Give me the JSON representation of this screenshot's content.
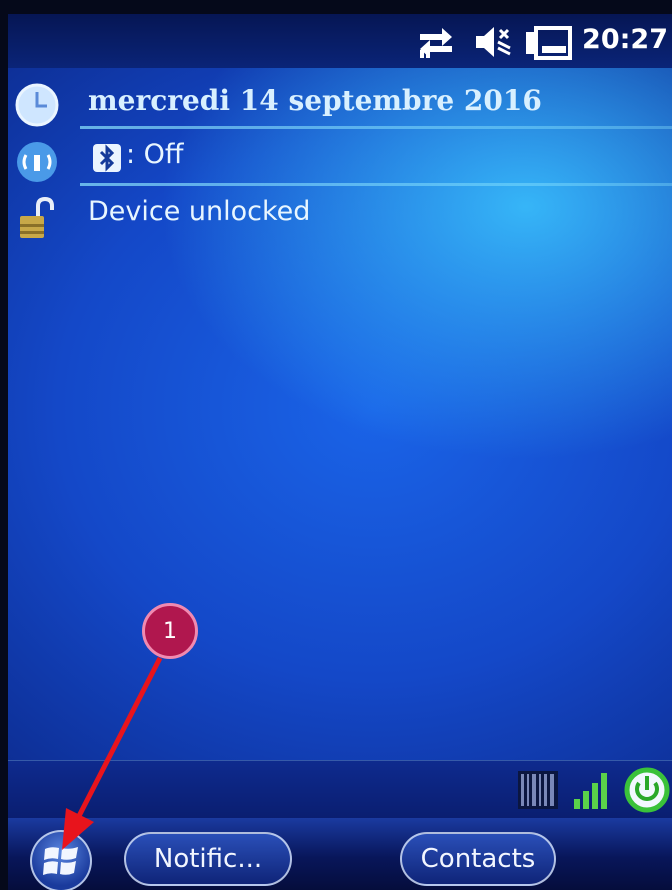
{
  "status_bar": {
    "time": "20:27",
    "icons": [
      "connectivity-arrows-icon",
      "speaker-muted-icon",
      "battery-icon"
    ]
  },
  "today": {
    "date": "mercredi 14 septembre 2016",
    "bluetooth_status": ": Off",
    "lock_status": "Device unlocked",
    "icons": [
      "clock-icon",
      "wireless-icon",
      "bluetooth-icon",
      "unlocked-padlock-icon"
    ]
  },
  "tray": {
    "icons": [
      "barcode-scanner-icon",
      "signal-strength-icon",
      "power-icon"
    ]
  },
  "softkeys": {
    "start_icon": "windows-start-icon",
    "left_label": "Notific...",
    "right_label": "Contacts"
  },
  "annotation": {
    "badge_label": "1",
    "color": "#e8141c"
  },
  "colors": {
    "background": "#1448c8",
    "status_bar": "#061654",
    "annotation_badge": "#b0174e"
  }
}
